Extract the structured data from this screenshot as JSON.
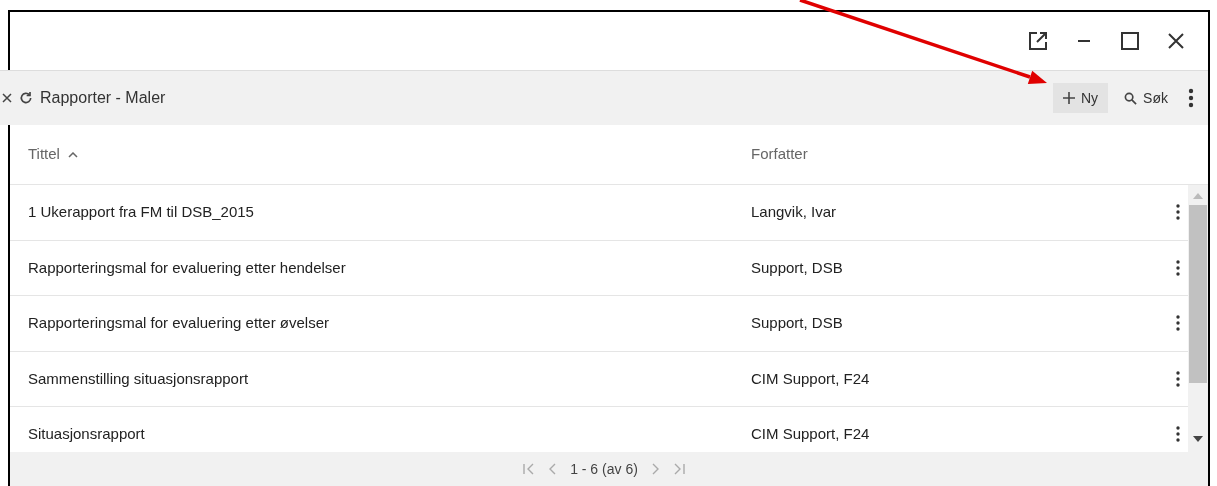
{
  "toolbar": {
    "title": "Rapporter - Maler",
    "buttons": [
      {
        "kind": "new",
        "label": "Ny",
        "highlighted": true
      },
      {
        "kind": "search",
        "label": "Søk",
        "highlighted": false
      }
    ]
  },
  "table": {
    "columns": [
      {
        "label": "Tittel",
        "sorted": true
      },
      {
        "label": "Forfatter",
        "sorted": false
      }
    ],
    "rows": [
      {
        "title": "1 Ukerapport fra FM til DSB_2015",
        "author": "Langvik, Ivar"
      },
      {
        "title": "Rapporteringsmal for evaluering etter hendelser",
        "author": "Support, DSB"
      },
      {
        "title": "Rapporteringsmal for evaluering etter øvelser",
        "author": "Support, DSB"
      },
      {
        "title": "Sammenstilling situasjonsrapport",
        "author": "CIM Support, F24"
      },
      {
        "title": "Situasjonsrapport",
        "author": "CIM Support, F24"
      }
    ]
  },
  "pagination": {
    "range": "1 - 6 (av 6)",
    "disabled": true
  }
}
